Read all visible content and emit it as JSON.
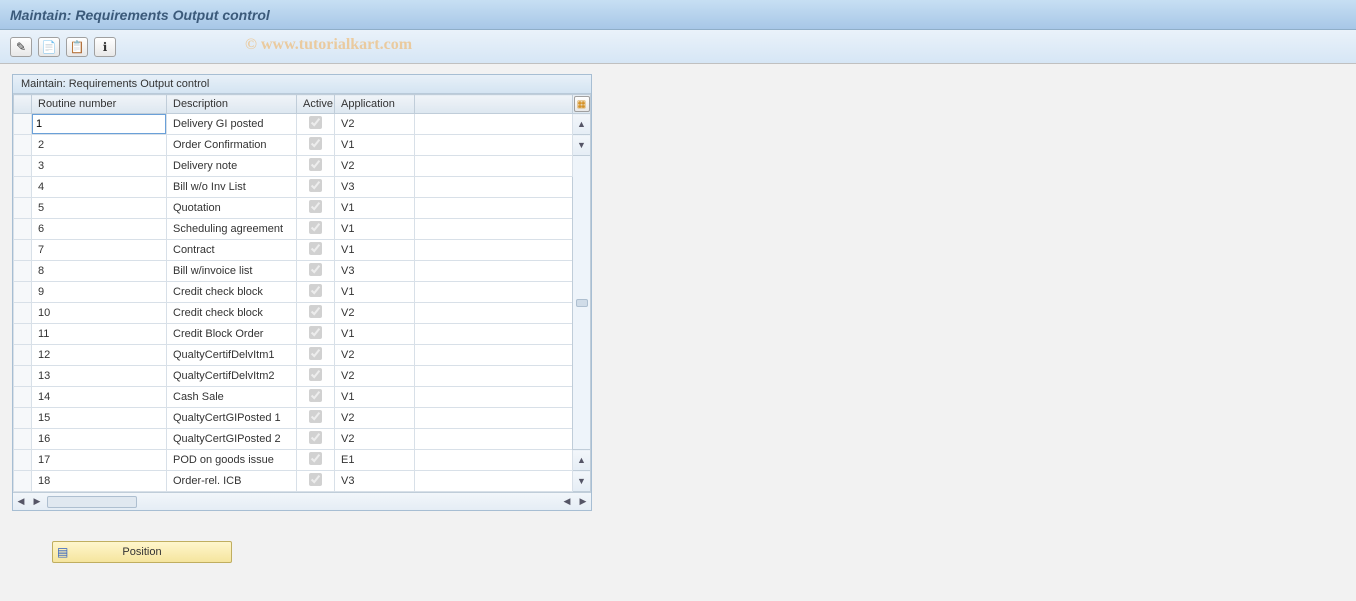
{
  "title": "Maintain: Requirements Output control",
  "watermark": "© www.tutorialkart.com",
  "toolbar": {
    "b1": "✎",
    "b2": "📄",
    "b3": "📋",
    "b4": "ℹ"
  },
  "panel_title": "Maintain: Requirements Output control",
  "columns": {
    "routine": "Routine number",
    "description": "Description",
    "active": "Active",
    "application": "Application"
  },
  "rows": [
    {
      "n": "1",
      "desc": "Delivery GI posted",
      "active": true,
      "app": "V2",
      "selected": true
    },
    {
      "n": "2",
      "desc": "Order Confirmation",
      "active": true,
      "app": "V1"
    },
    {
      "n": "3",
      "desc": "Delivery note",
      "active": true,
      "app": "V2"
    },
    {
      "n": "4",
      "desc": "Bill w/o Inv List",
      "active": true,
      "app": "V3"
    },
    {
      "n": "5",
      "desc": "Quotation",
      "active": true,
      "app": "V1"
    },
    {
      "n": "6",
      "desc": "Scheduling agreement",
      "active": true,
      "app": "V1"
    },
    {
      "n": "7",
      "desc": "Contract",
      "active": true,
      "app": "V1"
    },
    {
      "n": "8",
      "desc": "Bill w/invoice list",
      "active": true,
      "app": "V3"
    },
    {
      "n": "9",
      "desc": "Credit check block",
      "active": true,
      "app": "V1"
    },
    {
      "n": "10",
      "desc": "Credit check block",
      "active": true,
      "app": "V2"
    },
    {
      "n": "11",
      "desc": "Credit Block Order",
      "active": true,
      "app": "V1"
    },
    {
      "n": "12",
      "desc": "QualtyCertifDelvItm1",
      "active": true,
      "app": "V2"
    },
    {
      "n": "13",
      "desc": "QualtyCertifDelvItm2",
      "active": true,
      "app": "V2"
    },
    {
      "n": "14",
      "desc": "Cash Sale",
      "active": true,
      "app": "V1"
    },
    {
      "n": "15",
      "desc": "QualtyCertGIPosted 1",
      "active": true,
      "app": "V2"
    },
    {
      "n": "16",
      "desc": "QualtyCertGIPosted 2",
      "active": true,
      "app": "V2"
    },
    {
      "n": "17",
      "desc": "POD on goods issue",
      "active": true,
      "app": "E1"
    },
    {
      "n": "18",
      "desc": "Order-rel. ICB",
      "active": true,
      "app": "V3"
    }
  ],
  "position_button": "Position"
}
